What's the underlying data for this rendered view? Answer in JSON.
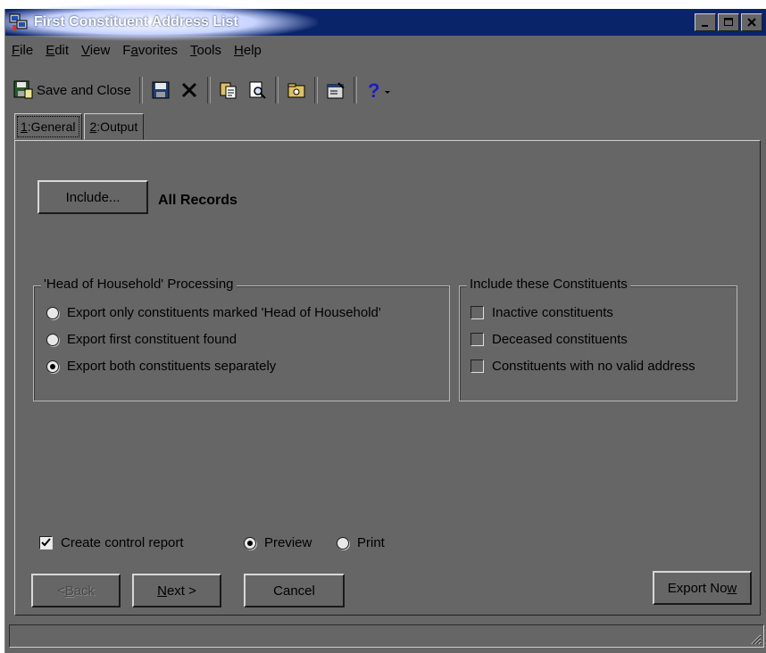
{
  "window": {
    "title": "First Constituent Address List",
    "controls": [
      "minimize-icon",
      "maximize-icon",
      "close-icon"
    ]
  },
  "menu": [
    {
      "key": "F",
      "rest": "ile"
    },
    {
      "key": "E",
      "rest": "dit"
    },
    {
      "key": "V",
      "rest": "iew"
    },
    {
      "pre": "F",
      "key": "a",
      "rest": "vorites"
    },
    {
      "key": "T",
      "rest": "ools"
    },
    {
      "key": "H",
      "rest": "elp"
    }
  ],
  "toolbar": {
    "save_close_label": "Save and Close",
    "icons": [
      "save-close-icon",
      "save-icon",
      "delete-icon",
      "copy-icon",
      "preview-icon",
      "export-icon",
      "properties-icon",
      "help-icon"
    ]
  },
  "tabs": [
    {
      "key": "1",
      "rest": ":General",
      "active": true
    },
    {
      "key": "2",
      "rest": ":Output",
      "active": false
    }
  ],
  "general": {
    "include_button": "Include...",
    "records_text": "All Records",
    "household": {
      "title": "'Head of Household' Processing",
      "options": [
        {
          "label": "Export only constituents marked 'Head of Household'",
          "selected": false
        },
        {
          "label": "Export first constituent found",
          "selected": false
        },
        {
          "label": "Export both constituents separately",
          "selected": true
        }
      ]
    },
    "include_constituents": {
      "title": "Include these Constituents",
      "options": [
        {
          "label": "Inactive constituents",
          "checked": false
        },
        {
          "label": "Deceased constituents",
          "checked": false
        },
        {
          "label": "Constituents with no valid address",
          "checked": false
        }
      ]
    },
    "control_report": {
      "label": "Create control report",
      "checked": true,
      "preview_label": "Preview",
      "print_label": "Print",
      "selected": "Preview"
    }
  },
  "buttons": {
    "back": {
      "pre": "< ",
      "key": "B",
      "rest": "ack"
    },
    "next": {
      "key": "N",
      "rest": "ext >"
    },
    "cancel": "Cancel",
    "export_now": {
      "pre": "Export No",
      "key": "w",
      "rest": ""
    }
  },
  "colors": {
    "title_bar": "#0a246a",
    "window_bg": "#666666"
  }
}
